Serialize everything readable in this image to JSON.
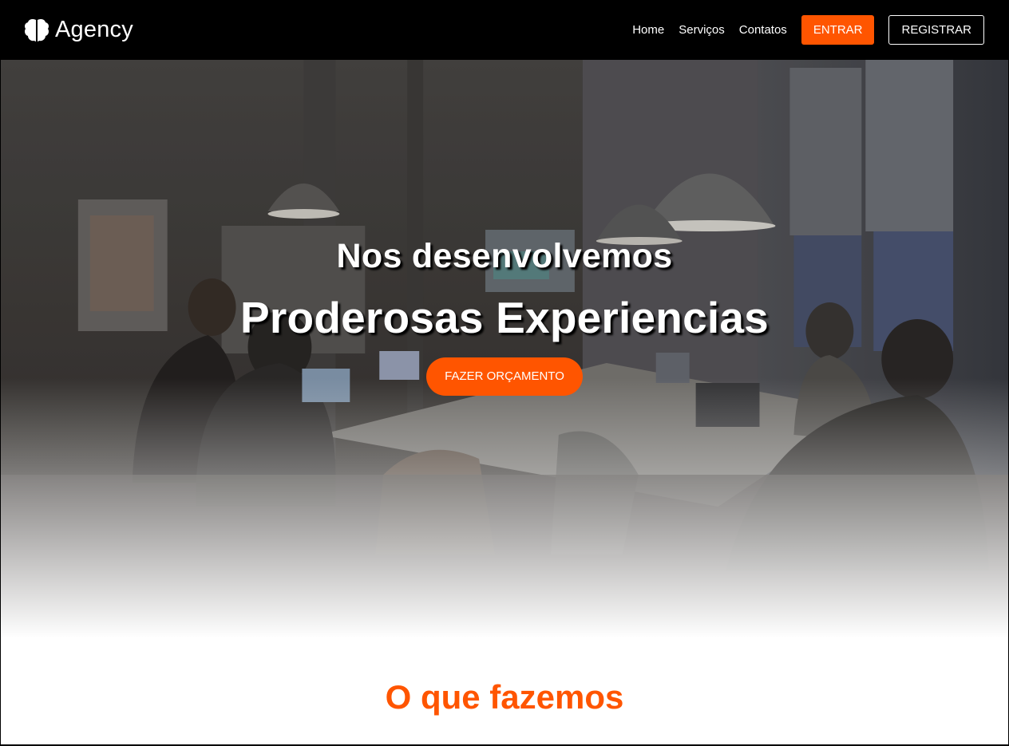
{
  "brand": {
    "name": "Agency",
    "icon": "brain-icon"
  },
  "nav": {
    "links": [
      "Home",
      "Serviços",
      "Contatos"
    ],
    "login_label": "ENTRAR",
    "register_label": "REGISTRAR"
  },
  "hero": {
    "subtitle": "Nos desenvolvemos",
    "title": "Proderosas Experiencias",
    "cta_label": "FAZER ORÇAMENTO"
  },
  "section": {
    "title": "O que fazemos"
  },
  "colors": {
    "accent": "#ff5500",
    "navbar": "#000000",
    "text_light": "#ffffff"
  }
}
